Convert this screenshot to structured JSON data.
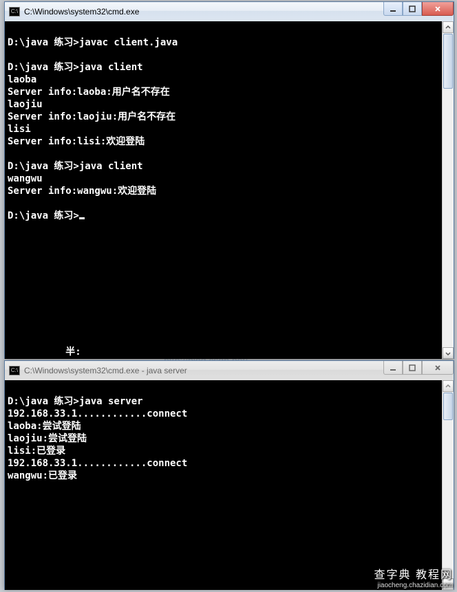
{
  "win1": {
    "title": "C:\\Windows\\system32\\cmd.exe",
    "lines": [
      "",
      "D:\\java 练习>javac client.java",
      "",
      "D:\\java 练习>java client",
      "laoba",
      "Server info:laoba:用户名不存在",
      "laojiu",
      "Server info:laojiu:用户名不存在",
      "lisi",
      "Server info:lisi:欢迎登陆",
      "",
      "D:\\java 练习>java client",
      "wangwu",
      "Server info:wangwu:欢迎登陆",
      "",
      "D:\\java 练习>"
    ],
    "cursor": true,
    "tail": "          半:"
  },
  "win2": {
    "title": "C:\\Windows\\system32\\cmd.exe - java  server",
    "lines": [
      "",
      "D:\\java 练习>java server",
      "192.168.33.1............connect",
      "laoba:尝试登陆",
      "laojiu:尝试登陆",
      "lisi:已登录",
      "192.168.33.1............connect",
      "wangwu:已登录"
    ],
    "cursor": false,
    "tail": ""
  },
  "bg_watermark": "http://blog.csdn.net/",
  "footer": {
    "l1": "查字典 教程网",
    "l2": "jiaocheng.chazidian.com"
  },
  "icon_label": "C:\\"
}
